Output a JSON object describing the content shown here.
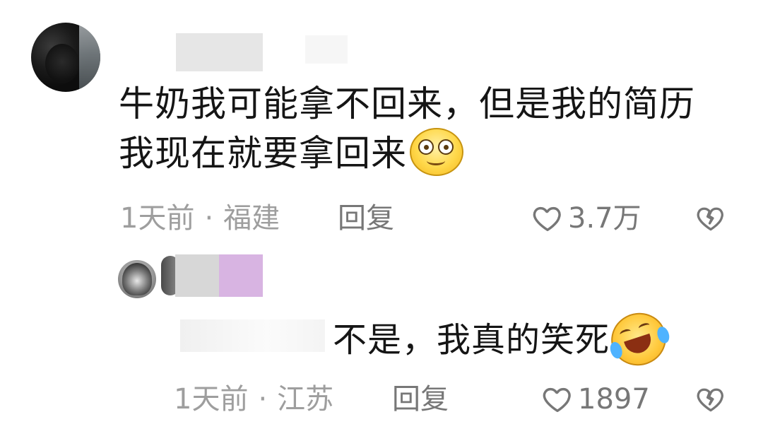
{
  "comment": {
    "text_line1": "牛奶我可能拿不回来，但是我的简历",
    "text_line2": "我现在就要拿回来",
    "emoji": "smile-emoji",
    "time": "1天前",
    "separator": "·",
    "location": "福建",
    "reply_label": "回复",
    "likes": "3.7万"
  },
  "reply": {
    "text": "不是，我真的笑死",
    "emoji": "laugh-cry-emoji",
    "time": "1天前",
    "separator": "·",
    "location": "江苏",
    "reply_label": "回复",
    "likes": "1897"
  },
  "colors": {
    "text": "#151515",
    "meta": "#9e9e9e",
    "action": "#777777",
    "purple_tag": "#d8b4e2"
  }
}
